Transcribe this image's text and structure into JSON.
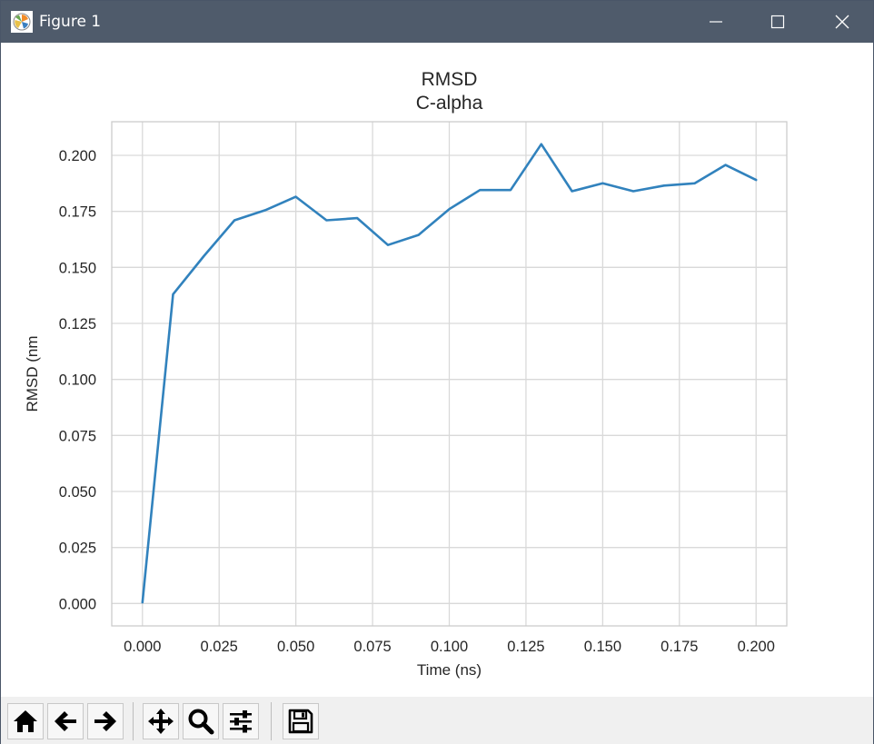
{
  "window": {
    "title": "Figure 1",
    "controls": [
      "minimize-icon",
      "maximize-icon",
      "close-icon"
    ]
  },
  "toolbar": {
    "buttons": [
      {
        "name": "home-button",
        "icon": "home-icon"
      },
      {
        "name": "back-button",
        "icon": "arrow-left-icon"
      },
      {
        "name": "forward-button",
        "icon": "arrow-right-icon"
      },
      {
        "name": "pan-button",
        "icon": "move-icon"
      },
      {
        "name": "zoom-button",
        "icon": "magnifier-icon"
      },
      {
        "name": "configure-subplots-button",
        "icon": "sliders-icon"
      },
      {
        "name": "save-button",
        "icon": "floppy-disk-icon"
      }
    ]
  },
  "chart_data": {
    "type": "line",
    "title": "RMSD",
    "subtitle": "C-alpha",
    "xlabel": "Time (ns)",
    "ylabel": "RMSD (nm",
    "xlim": [
      -0.01,
      0.21
    ],
    "ylim": [
      -0.01,
      0.215
    ],
    "xticks": [
      "0.000",
      "0.025",
      "0.050",
      "0.075",
      "0.100",
      "0.125",
      "0.150",
      "0.175",
      "0.200"
    ],
    "yticks": [
      "0.000",
      "0.025",
      "0.050",
      "0.075",
      "0.100",
      "0.125",
      "0.150",
      "0.175",
      "0.200"
    ],
    "grid": true,
    "line_color": "#3182bd",
    "series": [
      {
        "x": [
          0.0,
          0.01,
          0.02,
          0.03,
          0.04,
          0.05,
          0.06,
          0.07,
          0.08,
          0.09,
          0.1,
          0.11,
          0.12,
          0.13,
          0.14,
          0.15,
          0.16,
          0.17,
          0.18,
          0.19,
          0.2
        ],
        "values": [
          0.0005,
          0.138,
          0.155,
          0.171,
          0.1755,
          0.1815,
          0.171,
          0.172,
          0.16,
          0.1645,
          0.176,
          0.1845,
          0.1845,
          0.205,
          0.184,
          0.1875,
          0.184,
          0.1865,
          0.1875,
          0.1957,
          0.189
        ]
      }
    ]
  }
}
